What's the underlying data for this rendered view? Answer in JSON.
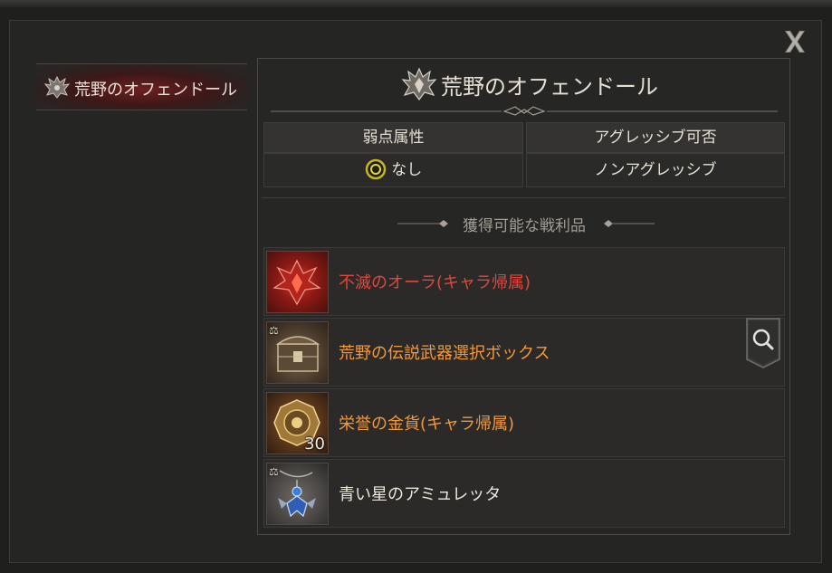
{
  "sidebar": {
    "items": [
      {
        "label": "荒野のオフェンドール",
        "icon": "boss-crest-icon",
        "selected": true
      }
    ]
  },
  "panel": {
    "title": "荒野のオフェンドール",
    "title_icon": "boss-crest-icon"
  },
  "info": {
    "weakness_header": "弱点属性",
    "weakness_value": "なし",
    "weakness_icon": "ring-target-icon",
    "aggressive_header": "アグレッシブ可否",
    "aggressive_value": "ノンアグレッシブ"
  },
  "loot": {
    "header": "獲得可能な戦利品",
    "items": [
      {
        "name": "不滅のオーラ(キャラ帰属)",
        "color": "#e0473c",
        "icon": "red-aura-icon"
      },
      {
        "name": "荒野の伝説武器選択ボックス",
        "color": "#f2993a",
        "icon": "treasure-chest-icon",
        "badge": "bound-icon"
      },
      {
        "name": "栄誉の金貨(キャラ帰属)",
        "color": "#f2993a",
        "icon": "gold-coin-icon",
        "quantity": "30"
      },
      {
        "name": "青い星のアミュレッタ",
        "color": "#ece6da",
        "icon": "blue-amulet-icon",
        "badge": "bound-icon"
      }
    ]
  },
  "colors": {
    "background": "#1f1f1e",
    "panel": "#262624",
    "legendary_text": "#f2993a",
    "red_text": "#e0473c",
    "normal_text": "#ece6da"
  }
}
